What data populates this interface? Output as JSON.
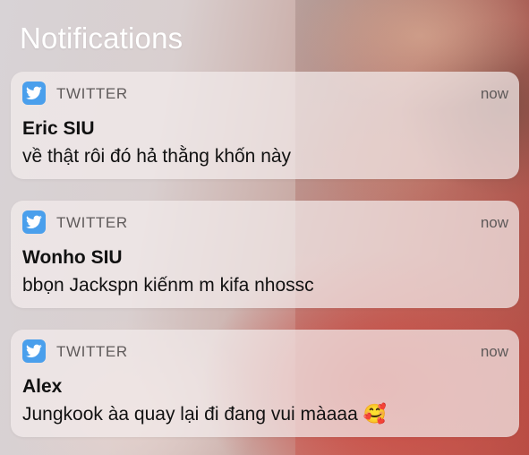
{
  "header": {
    "title": "Notifications"
  },
  "notifications": [
    {
      "app": "TWITTER",
      "app_icon": "twitter-bird-icon",
      "time": "now",
      "sender": "Eric SIU",
      "message": "về thật rôi đó hả thằng khốn này",
      "emoji": ""
    },
    {
      "app": "TWITTER",
      "app_icon": "twitter-bird-icon",
      "time": "now",
      "sender": "Wonho SIU",
      "message": "bbọn Jackspn kiếnm m kifa nhossc",
      "emoji": ""
    },
    {
      "app": "TWITTER",
      "app_icon": "twitter-bird-icon",
      "time": "now",
      "sender": "Alex",
      "message": "Jungkook àa quay lại đi đang vui màaaa",
      "emoji": "🥰"
    }
  ],
  "colors": {
    "twitter_blue": "#4a9fec",
    "card_background": "#f2ecec",
    "title_text": "#ffffff"
  }
}
